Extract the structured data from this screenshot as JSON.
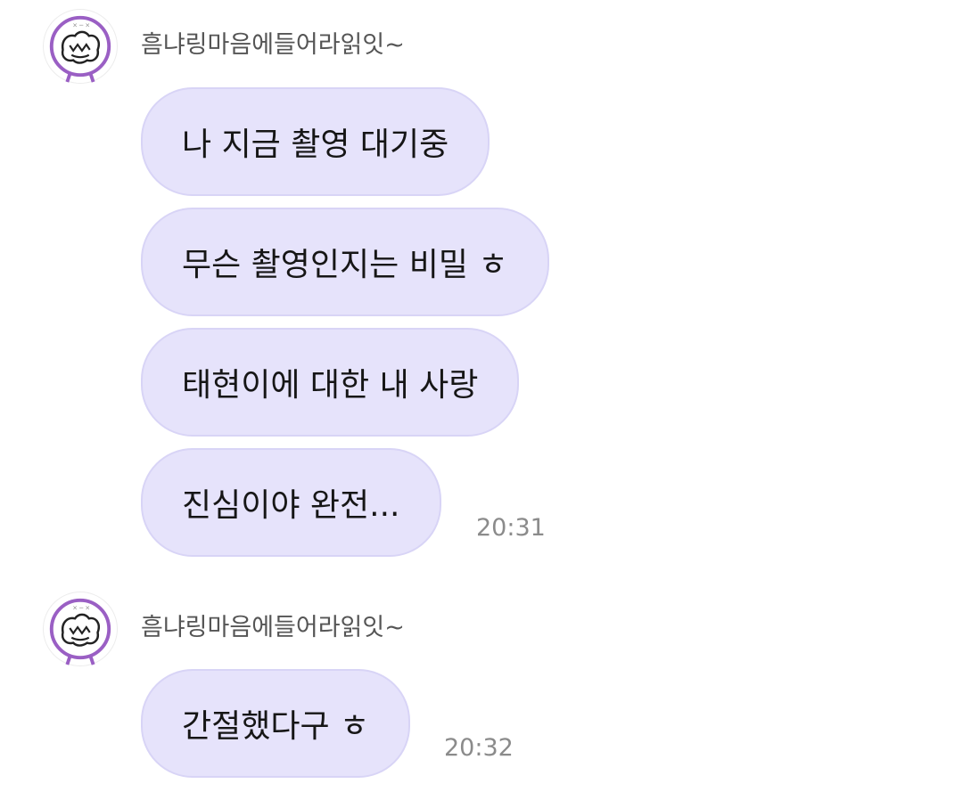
{
  "groups": [
    {
      "sender": "흠냐링마음에들어라읽잇~",
      "avatar_icon": "cartoon-face-icon",
      "messages": [
        "나 지금 촬영 대기중",
        "무슨 촬영인지는 비밀 ㅎ",
        "태현이에 대한 내 사랑",
        "진심이야 완전..."
      ],
      "time": "20:31"
    },
    {
      "sender": "흠냐링마음에들어라읽잇~",
      "avatar_icon": "cartoon-face-icon",
      "messages": [
        "간절했다구 ㅎ"
      ],
      "time": "20:32"
    }
  ],
  "colors": {
    "bubble_bg": "#e6e3fb",
    "bubble_border": "#d8d4f6",
    "avatar_ring": "#9a5fc4",
    "time_text": "#8b8b8b",
    "sender_text": "#555555"
  }
}
